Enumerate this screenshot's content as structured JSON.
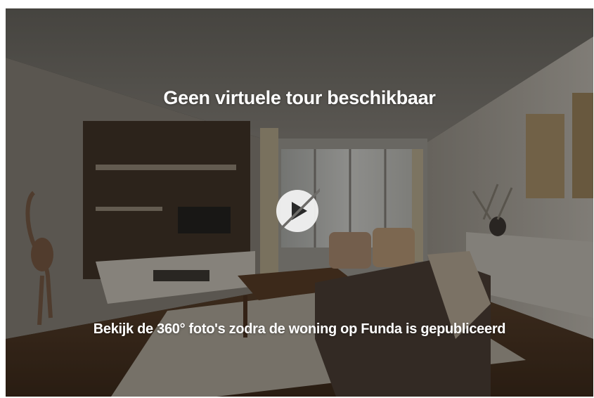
{
  "tour": {
    "title": "Geen virtuele tour beschikbaar",
    "subtitle": "Bekijk de 360° foto's zodra de woning op Funda is gepubliceerd",
    "play_icon": "play-disabled-icon"
  },
  "colors": {
    "overlay": "#14120f",
    "text": "#ffffff",
    "play_circle": "#f2f2f2",
    "play_glyph": "#2a2a2a"
  }
}
